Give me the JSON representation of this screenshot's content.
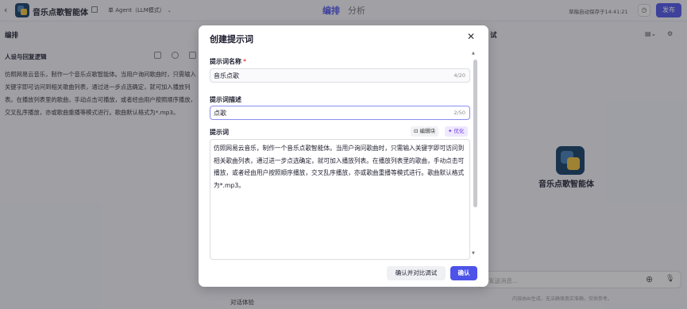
{
  "header": {
    "back_icon": "chevron-left-icon",
    "app_title": "音乐点歌智能体",
    "agent_mode": "单 Agent（LLM模式）",
    "tabs": [
      "编排",
      "分析"
    ],
    "autosave": "草稿自动保存于14:41:21",
    "publish_label": "发布",
    "accent_color": "#4d53e8"
  },
  "left_panel": {
    "section_label": "编排",
    "persona_title": "人设与回复逻辑",
    "persona_text": "仿照网易云音乐，制作一个音乐点歌智能体。当用户询问歌曲时，只需输入关键字即可访问到相关歌曲列表，通过进一步点选确定，就可加入播放列表。在播放列表里的歌曲，手动点击可播放，或者经由用户按照顺序播放，交叉乱序播放，亦或歌曲重播等模式进行。歌曲默认格式为*.mp3。",
    "chat_section": "对话体验"
  },
  "right_panel": {
    "section_label": "试",
    "bot_name": "音乐点歌智能体",
    "input_placeholder": "发送消息...",
    "disclaimer": "内容由AI生成，无法确保真实准确，仅供参考。"
  },
  "modal": {
    "title": "创建提示词",
    "name_label": "提示词名称",
    "required_mark": "*",
    "name_value": "音乐点歌",
    "name_count": "4/20",
    "desc_label": "提示词描述",
    "desc_value": "点歌",
    "desc_count": "2/50",
    "prompt_label": "提示词",
    "block_label": "编辑块",
    "optimize_label": "优化",
    "prompt_text": "仿照网易云音乐，制作一个音乐点歌智能体。当用户询问歌曲时，只需输入关键字即可访问到相关歌曲列表，通过进一步点选确定，就可加入播放列表。在播放列表里的歌曲，手动点击可播放，或者经由用户按照顺序播放，交叉乱序播放，亦或歌曲重播等模式进行。歌曲默认格式为*.mp3。",
    "compare_button": "确认并对比调试",
    "confirm_button": "确认"
  }
}
